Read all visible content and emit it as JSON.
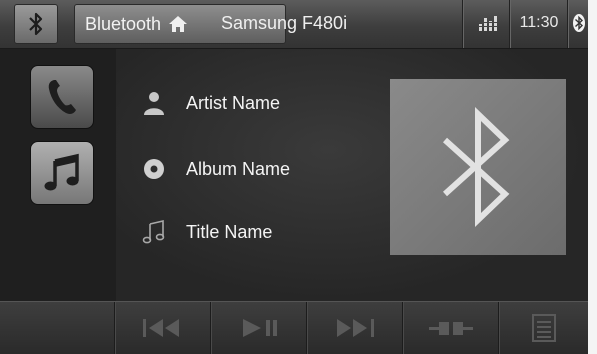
{
  "topbar": {
    "source_label": "Bluetooth",
    "device_name": "Samsung F480i",
    "clock": "11:30",
    "icons": [
      "bluetooth-icon",
      "home-icon",
      "equalizer-icon",
      "bluetooth-status-icon"
    ]
  },
  "modes": [
    {
      "name": "phone",
      "icon": "phone-icon",
      "active": false
    },
    {
      "name": "music",
      "icon": "music-note-icon",
      "active": true
    }
  ],
  "track": {
    "artist": "Artist Name",
    "album": "Album Name",
    "title": "Title Name"
  },
  "controls": [
    "previous-track-icon",
    "play-pause-icon",
    "next-track-icon",
    "connection-icon",
    "menu-icon"
  ],
  "colors": {
    "background": "#2b2b2b",
    "topbar": "#4a4a4a",
    "artwork": "#7c7c7c",
    "text": "#f4f4f4"
  }
}
